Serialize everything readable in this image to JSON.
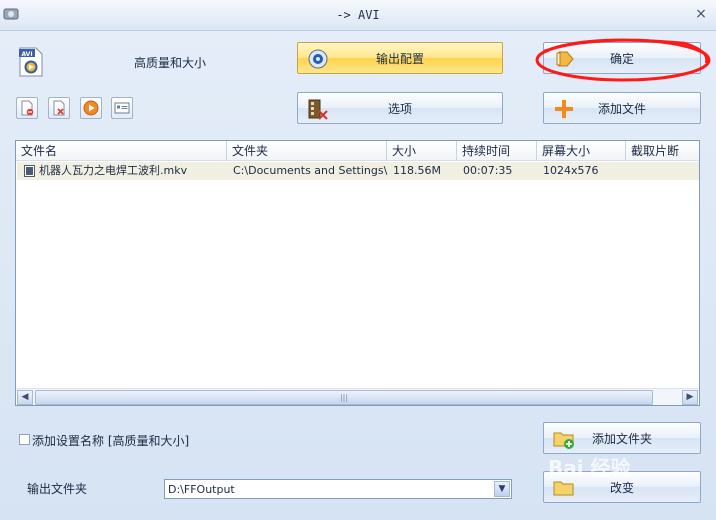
{
  "window": {
    "title": "-> AVI",
    "close_symbol": "×"
  },
  "profile": {
    "label": "高质量和大小",
    "icon": "avi-file-icon"
  },
  "toolbar": {
    "small_tools": [
      "remove-file-icon",
      "delete-all-icon",
      "play-icon",
      "info-icon"
    ],
    "output_config_label": "输出配置",
    "options_label": "选项",
    "ok_label": "确定",
    "add_file_label": "添加文件",
    "add_folder_label": "添加文件夹",
    "change_label": "改变"
  },
  "file_list": {
    "columns": [
      "文件名",
      "文件夹",
      "大小",
      "持续时间",
      "屏幕大小",
      "截取片断"
    ],
    "rows": [
      {
        "name": "机器人瓦力之电焊工波利.mkv",
        "folder": "C:\\Documents and Settings\\...",
        "size": "118.56M",
        "duration": "00:07:35",
        "screen_size": "1024x576",
        "clip": ""
      }
    ],
    "scroll_grip": "|||"
  },
  "settings": {
    "add_setting_name_label": "添加设置名称 [高质量和大小]",
    "add_setting_name_checked": false,
    "output_folder_label": "输出文件夹",
    "output_folder_value": "D:\\FFOutput"
  },
  "watermark": "Bai 经验",
  "colors": {
    "accent_yellow": "#ffd24a",
    "annotation_red": "#ff1a1a",
    "list_border": "#7f9db9"
  }
}
